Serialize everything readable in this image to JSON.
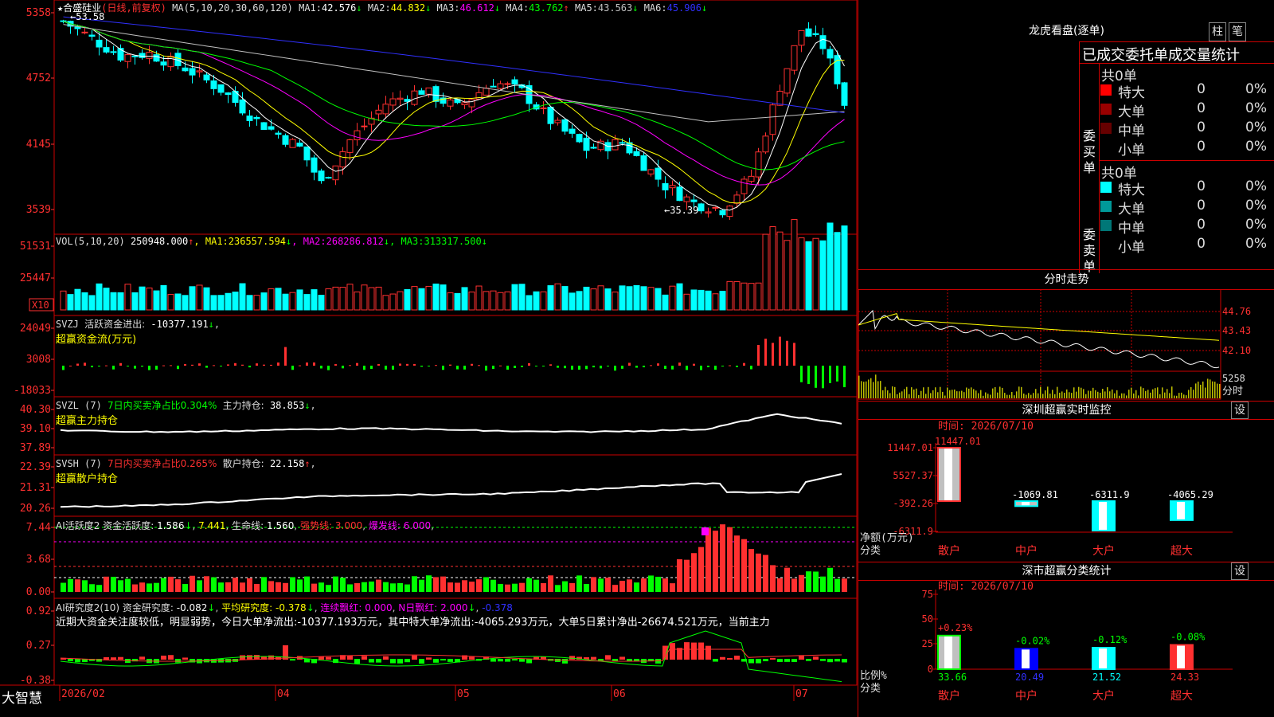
{
  "main": {
    "stock": "★合盛硅业",
    "period_tag": "(日线,前复权)",
    "ma_header": "MA(5,10,20,30,60,120)",
    "ma": [
      {
        "k": "MA1:",
        "v": "42.576",
        "t": "↓",
        "c": "#ffffff"
      },
      {
        "k": "MA2:",
        "v": "44.832",
        "t": "↓",
        "c": "#ffff00"
      },
      {
        "k": "MA3:",
        "v": "46.612",
        "t": "↓",
        "c": "#ff00ff"
      },
      {
        "k": "MA4:",
        "v": "43.762",
        "t": "↑",
        "c": "#00ff00"
      },
      {
        "k": "MA5:",
        "v": "43.563",
        "t": "↓",
        "c": "#c0c0c0"
      },
      {
        "k": "MA6:",
        "v": "45.906",
        "t": "↓",
        "c": "#3030ff"
      }
    ],
    "y_ticks": [
      "5358",
      "4752",
      "4145",
      "3539"
    ],
    "high_label": "53.58",
    "low_label": "35.39"
  },
  "vol": {
    "name": "VOL(5,10,20)",
    "value": "250948.000",
    "v_trend": "↑",
    "ma": [
      {
        "k": "MA1:",
        "v": "236557.594",
        "t": "↓",
        "c": "#ffff00"
      },
      {
        "k": "MA2:",
        "v": "268286.812",
        "t": "↓",
        "c": "#ff00ff"
      },
      {
        "k": "MA3:",
        "v": "313317.500",
        "t": "↓",
        "c": "#00ff00"
      }
    ],
    "y_ticks": [
      "51531",
      "25447"
    ],
    "unit": "X10"
  },
  "svzj": {
    "name": "SVZJ",
    "label": "活跃资金进出:",
    "value": "-10377.191",
    "trend": "↓",
    "subtitle": "超赢资金流(万元)",
    "y_ticks": [
      "24049",
      "3008",
      "-18033"
    ]
  },
  "svzl": {
    "name": "SVZL (7)",
    "label1": "7日内买卖净占比0.304%",
    "label2": "主力持仓:",
    "value": "38.853",
    "trend": "↓",
    "subtitle": "超赢主力持仓",
    "y_ticks": [
      "40.30",
      "39.10",
      "37.89"
    ]
  },
  "svsh": {
    "name": "SVSH (7)",
    "label1": "7日内买卖净占比0.265%",
    "label2": "散户持仓:",
    "value": "22.158",
    "trend": "↑",
    "subtitle": "超赢散户持仓",
    "y_ticks": [
      "22.39",
      "21.31",
      "20.26"
    ]
  },
  "ai_active": {
    "name": "AI活跃度2",
    "label": "资金活跃度:",
    "v1": "1.586",
    "t1": "↓",
    "v2": "7.441",
    "t2": "",
    "life_label": "生命线:",
    "life": "1.560",
    "strong_label": "强势线:",
    "strong": "3.000",
    "burst_label": "爆发线:",
    "burst": "6.000",
    "y_ticks": [
      "7.44",
      "3.68",
      "0.00"
    ]
  },
  "ai_research": {
    "name": "AI研究度2(10)",
    "label": "资金研究度:",
    "value": "-0.082",
    "trend": "↓",
    "avg_label": "平均研究度:",
    "avg": "-0.378",
    "avg_trend": "↓",
    "red_label": "连续飘红:",
    "red": "0.000",
    "n_label": "N日飘红:",
    "n": "2.000",
    "n_trend": "↓",
    "last": "-0.378",
    "commentary": "近期大资金关注度较低，明显弱势，今日大单净流出:-10377.193万元，其中特大单净流出:-4065.293万元，大单5日累计净出-26674.521万元，当前主力",
    "y_ticks": [
      "0.92",
      "0.27",
      "-0.38"
    ]
  },
  "xaxis": {
    "app": "大智慧",
    "labels": [
      "2026/02",
      "04",
      "05",
      "06",
      "07"
    ]
  },
  "lhb": {
    "title": "龙虎看盘(逐单)",
    "btn_bar": "柱",
    "btn_tick": "笔",
    "stats_title": "已成交委托单成交量统计",
    "buy_side": "委买单",
    "sell_side": "委卖单",
    "buy_total": "共0单",
    "sell_total": "共0单",
    "buy_rows": [
      {
        "name": "特大",
        "n": "0",
        "pct": "0%",
        "c": "#ff0000"
      },
      {
        "name": "大单",
        "n": "0",
        "pct": "0%",
        "c": "#990000"
      },
      {
        "name": "中单",
        "n": "0",
        "pct": "0%",
        "c": "#660000"
      },
      {
        "name": "小单",
        "n": "0",
        "pct": "0%",
        "c": ""
      }
    ],
    "sell_rows": [
      {
        "name": "特大",
        "n": "0",
        "pct": "0%",
        "c": "#00ffff"
      },
      {
        "name": "大单",
        "n": "0",
        "pct": "0%",
        "c": "#009999"
      },
      {
        "name": "中单",
        "n": "0",
        "pct": "0%",
        "c": "#007777"
      },
      {
        "name": "小单",
        "n": "0",
        "pct": "0%",
        "c": ""
      }
    ]
  },
  "intraday": {
    "title": "分时走势",
    "y_ticks": [
      "44.76",
      "43.43",
      "42.10"
    ],
    "vol_tick": "5258",
    "unit": "分时"
  },
  "sz_monitor": {
    "title": "深圳超赢实时监控",
    "btn": "设",
    "time": "时间: 2026/07/10",
    "y_ticks": [
      "11447.01",
      "5527.37",
      "-392.26",
      "-6311.9"
    ],
    "ylabel": "净额(万元)",
    "xlabel": "分类",
    "chart_data": {
      "type": "bar",
      "categories": [
        "散户",
        "中户",
        "大户",
        "超大"
      ],
      "values": [
        11447.01,
        -1069.81,
        -6311.9,
        -4065.29
      ],
      "labels": [
        "11447.01",
        "-1069.81",
        "-6311.9",
        "-4065.29"
      ],
      "ylim": [
        -6311.9,
        11447.01
      ]
    }
  },
  "sz_class": {
    "title": "深市超赢分类统计",
    "btn": "设",
    "time": "时间: 2026/07/10",
    "y_ticks": [
      "75",
      "50",
      "25",
      "0"
    ],
    "ylabel": "比例%",
    "xlabel": "分类",
    "chart_data": {
      "type": "bar",
      "categories": [
        "散户",
        "中户",
        "大户",
        "超大"
      ],
      "values": [
        33.66,
        20.49,
        21.52,
        24.33
      ],
      "changes": [
        "+0.23%",
        "-0.02%",
        "-0.12%",
        "-0.08%"
      ],
      "labels": [
        "33.66",
        "20.49",
        "21.52",
        "24.33"
      ],
      "ylim": [
        0,
        75
      ]
    }
  }
}
